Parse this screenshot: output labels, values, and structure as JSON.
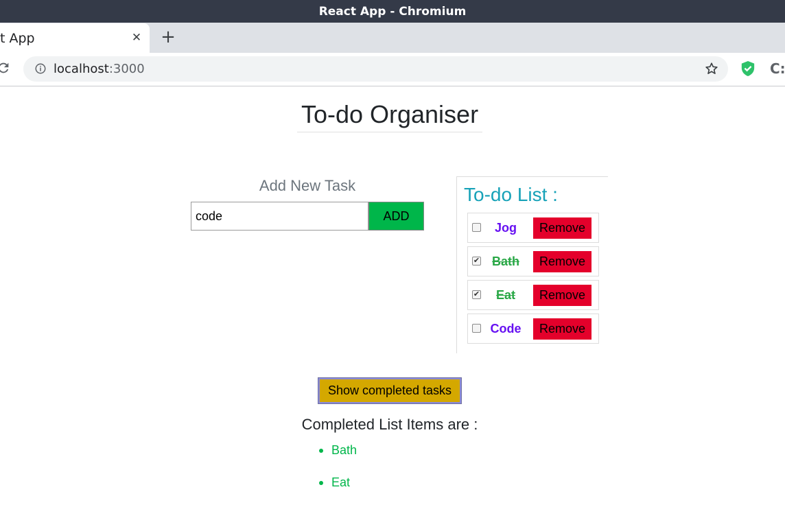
{
  "browser": {
    "window_title": "React App - Chromium",
    "tab_title": "t App",
    "tab_close": "✕",
    "new_tab": "+",
    "url_host": "localhost",
    "url_port": ":3000",
    "icons": [
      "reload-icon",
      "info-icon",
      "star-icon",
      "shield-extension-icon",
      "extension-c-icon"
    ]
  },
  "app": {
    "title": "To-do Organiser",
    "add_section": {
      "heading": "Add New Task",
      "input_value": "code",
      "add_label": "ADD"
    },
    "todo_list": {
      "heading": "To-do List :",
      "remove_label": "Remove",
      "items": [
        {
          "name": "Jog",
          "checked": false
        },
        {
          "name": "Bath",
          "checked": true
        },
        {
          "name": "Eat",
          "checked": true
        },
        {
          "name": "Code",
          "checked": false
        }
      ]
    },
    "show_completed_label": "Show completed tasks",
    "completed": {
      "heading": "Completed List Items are :",
      "items": [
        "Bath",
        "Eat"
      ]
    },
    "colors": {
      "add_button": "#00b64a",
      "remove_button": "#e4002b",
      "show_button": "#d4a800",
      "todo_heading": "#17a2b8",
      "pending_task": "#6610f2",
      "done_task": "#28a745"
    }
  }
}
